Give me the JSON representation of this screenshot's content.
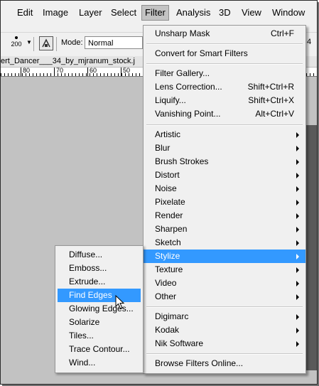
{
  "menubar": {
    "items": [
      "Edit",
      "Image",
      "Layer",
      "Select",
      "Filter",
      "Analysis",
      "3D",
      "View",
      "Window"
    ],
    "active": "Filter"
  },
  "options_bar": {
    "brush_size": "200",
    "mode_label": "Mode:",
    "mode_value": "Normal",
    "opacity_partial": "4"
  },
  "document": {
    "tab_title": "ert_Dancer___34_by_mjranum_stock.j",
    "ruler_numbers": [
      "80",
      "70",
      "60",
      "50"
    ]
  },
  "filter_menu": {
    "last_filter": {
      "label": "Unsharp Mask",
      "shortcut": "Ctrl+F"
    },
    "convert_label": "Convert for Smart Filters",
    "special_items": [
      {
        "label": "Filter Gallery...",
        "shortcut": ""
      },
      {
        "label": "Lens Correction...",
        "shortcut": "Shift+Ctrl+R"
      },
      {
        "label": "Liquify...",
        "shortcut": "Shift+Ctrl+X"
      },
      {
        "label": "Vanishing Point...",
        "shortcut": "Alt+Ctrl+V"
      }
    ],
    "categories": [
      "Artistic",
      "Blur",
      "Brush Strokes",
      "Distort",
      "Noise",
      "Pixelate",
      "Render",
      "Sharpen",
      "Sketch",
      "Stylize",
      "Texture",
      "Video",
      "Other"
    ],
    "highlighted_category": "Stylize",
    "plugins": [
      "Digimarc",
      "Kodak",
      "Nik Software"
    ],
    "browse_label": "Browse Filters Online..."
  },
  "stylize_submenu": {
    "items": [
      "Diffuse...",
      "Emboss...",
      "Extrude...",
      "Find Edges",
      "Glowing Edges...",
      "Solarize",
      "Tiles...",
      "Trace Contour...",
      "Wind..."
    ],
    "highlighted": "Find Edges"
  },
  "colors": {
    "highlight": "#3399ff",
    "menu_bg": "#f0f0f0",
    "canvas_bg": "#c2c2c2"
  }
}
